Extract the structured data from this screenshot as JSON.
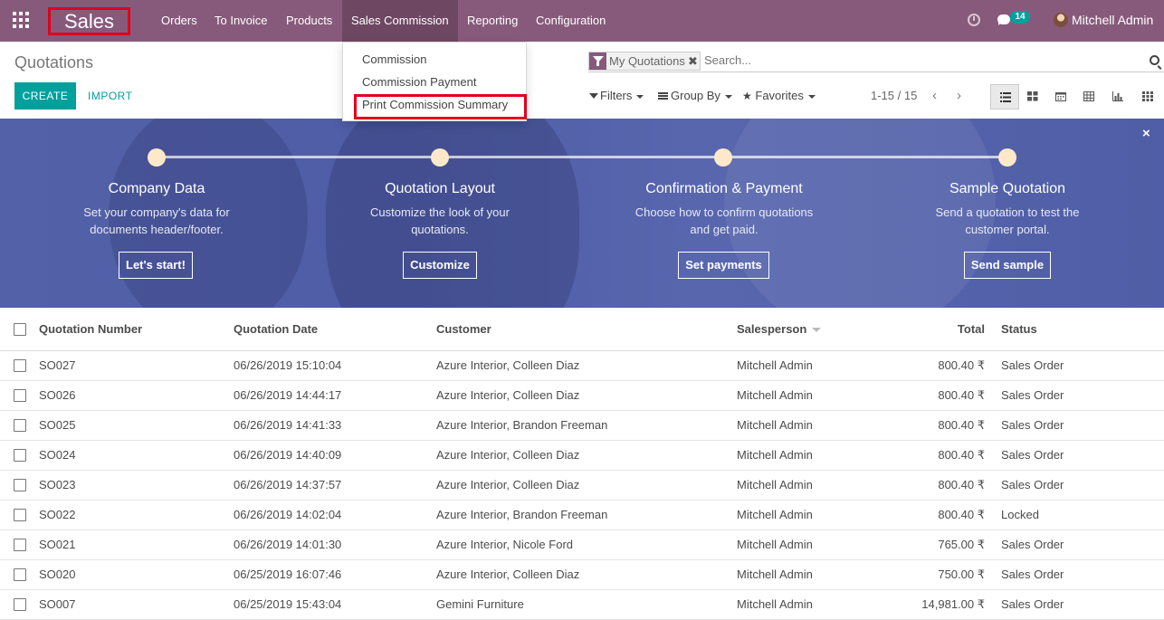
{
  "navbar": {
    "brand": "Sales",
    "menu": [
      "Orders",
      "To Invoice",
      "Products",
      "Sales Commission",
      "Reporting",
      "Configuration"
    ],
    "active_menu": "Sales Commission",
    "messages_count": "14",
    "user": "Mitchell Admin"
  },
  "dropdown": {
    "items": [
      "Commission",
      "Commission Payment",
      "Print Commission Summary"
    ],
    "highlighted": "Print Commission Summary"
  },
  "control_panel": {
    "breadcrumb": "Quotations",
    "create_label": "CREATE",
    "import_label": "IMPORT",
    "facet": "My Quotations",
    "facet_remove": "✖",
    "search_placeholder": "Search...",
    "filters_label": "Filters",
    "group_by_label": "Group By",
    "favorites_label": "Favorites",
    "pager": "1-15 / 15",
    "pager_prev": "‹",
    "pager_next": "›",
    "views": [
      "list",
      "kanban",
      "calendar",
      "pivot",
      "graph",
      "activity"
    ],
    "active_view": "list"
  },
  "banner": {
    "close": "×",
    "steps": [
      {
        "title": "Company Data",
        "desc": "Set your company's data for documents header/footer.",
        "button": "Let's start!"
      },
      {
        "title": "Quotation Layout",
        "desc": "Customize the look of your quotations.",
        "button": "Customize"
      },
      {
        "title": "Confirmation & Payment",
        "desc": "Choose how to confirm quotations and get paid.",
        "button": "Set payments"
      },
      {
        "title": "Sample Quotation",
        "desc": "Send a quotation to test the customer portal.",
        "button": "Send sample"
      }
    ]
  },
  "table": {
    "headers": {
      "number": "Quotation Number",
      "date": "Quotation Date",
      "customer": "Customer",
      "salesperson": "Salesperson",
      "total": "Total",
      "status": "Status"
    },
    "rows": [
      {
        "number": "SO027",
        "date": "06/26/2019 15:10:04",
        "customer": "Azure Interior, Colleen Diaz",
        "salesperson": "Mitchell Admin",
        "total": "800.40 ₹",
        "status": "Sales Order"
      },
      {
        "number": "SO026",
        "date": "06/26/2019 14:44:17",
        "customer": "Azure Interior, Colleen Diaz",
        "salesperson": "Mitchell Admin",
        "total": "800.40 ₹",
        "status": "Sales Order"
      },
      {
        "number": "SO025",
        "date": "06/26/2019 14:41:33",
        "customer": "Azure Interior, Brandon Freeman",
        "salesperson": "Mitchell Admin",
        "total": "800.40 ₹",
        "status": "Sales Order"
      },
      {
        "number": "SO024",
        "date": "06/26/2019 14:40:09",
        "customer": "Azure Interior, Colleen Diaz",
        "salesperson": "Mitchell Admin",
        "total": "800.40 ₹",
        "status": "Sales Order"
      },
      {
        "number": "SO023",
        "date": "06/26/2019 14:37:57",
        "customer": "Azure Interior, Colleen Diaz",
        "salesperson": "Mitchell Admin",
        "total": "800.40 ₹",
        "status": "Sales Order"
      },
      {
        "number": "SO022",
        "date": "06/26/2019 14:02:04",
        "customer": "Azure Interior, Brandon Freeman",
        "salesperson": "Mitchell Admin",
        "total": "800.40 ₹",
        "status": "Locked"
      },
      {
        "number": "SO021",
        "date": "06/26/2019 14:01:30",
        "customer": "Azure Interior, Nicole Ford",
        "salesperson": "Mitchell Admin",
        "total": "765.00 ₹",
        "status": "Sales Order"
      },
      {
        "number": "SO020",
        "date": "06/25/2019 16:07:46",
        "customer": "Azure Interior, Colleen Diaz",
        "salesperson": "Mitchell Admin",
        "total": "750.00 ₹",
        "status": "Sales Order"
      },
      {
        "number": "SO007",
        "date": "06/25/2019 15:43:04",
        "customer": "Gemini Furniture",
        "salesperson": "Mitchell Admin",
        "total": "14,981.00 ₹",
        "status": "Sales Order"
      }
    ]
  },
  "colors": {
    "brand": "#875a7b",
    "accent": "#00a09d",
    "highlight": "#e0001b",
    "banner": "#5361a8"
  }
}
